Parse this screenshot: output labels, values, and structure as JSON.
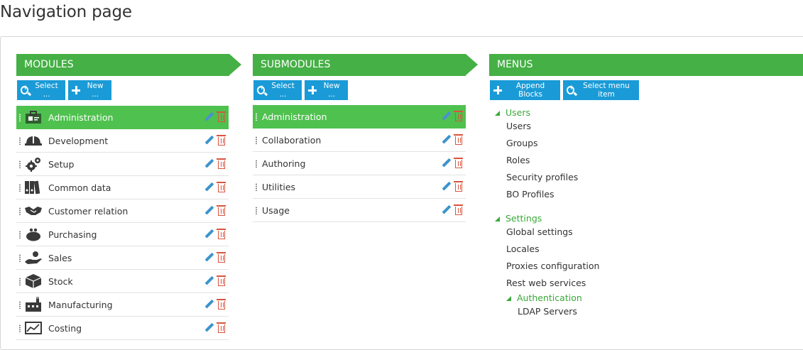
{
  "page": {
    "title": "Navigation page"
  },
  "modules": {
    "header": "MODULES",
    "buttons": {
      "select": "Select ...",
      "new": "New ..."
    },
    "items": [
      {
        "label": "Administration",
        "icon": "id-card-icon",
        "active": true
      },
      {
        "label": "Development",
        "icon": "hard-hat-icon"
      },
      {
        "label": "Setup",
        "icon": "gears-icon"
      },
      {
        "label": "Common data",
        "icon": "binders-icon"
      },
      {
        "label": "Customer relation",
        "icon": "handshake-icon"
      },
      {
        "label": "Purchasing",
        "icon": "purse-icon"
      },
      {
        "label": "Sales",
        "icon": "money-hand-icon"
      },
      {
        "label": "Stock",
        "icon": "box-icon"
      },
      {
        "label": "Manufacturing",
        "icon": "factory-icon"
      },
      {
        "label": "Costing",
        "icon": "chart-icon"
      }
    ]
  },
  "submodules": {
    "header": "SUBMODULES",
    "buttons": {
      "select": "Select ...",
      "new": "New ..."
    },
    "items": [
      {
        "label": "Administration",
        "active": true
      },
      {
        "label": "Collaboration"
      },
      {
        "label": "Authoring"
      },
      {
        "label": "Utilities"
      },
      {
        "label": "Usage"
      }
    ]
  },
  "menus": {
    "header": "MENUS",
    "buttons": {
      "append": "Append Blocks",
      "select_item": "Select menu item"
    },
    "groups": [
      {
        "label": "Users",
        "items": [
          "Users",
          "Groups",
          "Roles",
          "Security profiles",
          "BO Profiles"
        ]
      },
      {
        "label": "Settings",
        "items": [
          "Global settings",
          "Locales",
          "Proxies configuration",
          "Rest web services"
        ]
      }
    ],
    "sub_group": {
      "label": "Authentication",
      "items": [
        "LDAP Servers"
      ]
    }
  },
  "colors": {
    "header_green": "#45b045",
    "active_green": "#4fc14f",
    "button_blue": "#1a9bd7",
    "tree_green": "#39a939"
  }
}
